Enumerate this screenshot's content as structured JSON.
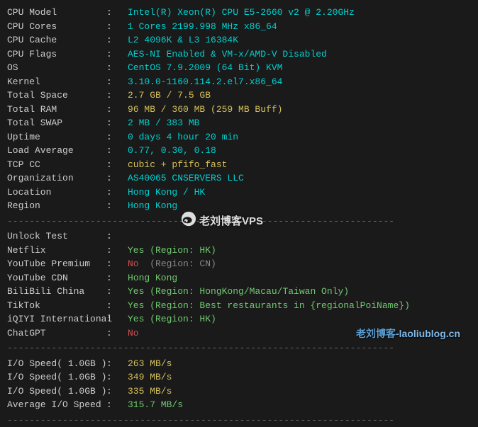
{
  "system": {
    "cpu_model": {
      "label": "CPU Model",
      "value": "Intel(R) Xeon(R) CPU E5-2660 v2 @ 2.20GHz"
    },
    "cpu_cores": {
      "label": "CPU Cores",
      "value": "1 Cores 2199.998 MHz x86_64"
    },
    "cpu_cache": {
      "label": "CPU Cache",
      "value": "L2 4096K & L3 16384K"
    },
    "cpu_flags": {
      "label": "CPU Flags",
      "value": "AES-NI Enabled & VM-x/AMD-V Disabled"
    },
    "os": {
      "label": "OS",
      "value": "CentOS 7.9.2009 (64 Bit) KVM"
    },
    "kernel": {
      "label": "Kernel",
      "value": "3.10.0-1160.114.2.el7.x86_64"
    },
    "total_space": {
      "label": "Total Space",
      "value": "2.7 GB / 7.5 GB"
    },
    "total_ram": {
      "label": "Total RAM",
      "value": "96 MB / 360 MB (259 MB Buff)"
    },
    "total_swap": {
      "label": "Total SWAP",
      "value": "2 MB / 383 MB"
    },
    "uptime": {
      "label": "Uptime",
      "value": "0 days 4 hour 20 min"
    },
    "load_avg": {
      "label": "Load Average",
      "value": "0.77, 0.30, 0.18"
    },
    "tcp_cc": {
      "label": "TCP CC",
      "value": "cubic + pfifo_fast"
    },
    "organization": {
      "label": "Organization",
      "value": "AS40065 CNSERVERS LLC"
    },
    "location": {
      "label": "Location",
      "value": "Hong Kong / HK"
    },
    "region": {
      "label": "Region",
      "value": "Hong Kong"
    }
  },
  "unlock": {
    "header": {
      "label": "Unlock Test",
      "value": ""
    },
    "netflix": {
      "label": "Netflix",
      "status": "Yes",
      "detail": " (Region: HK)"
    },
    "youtube_premium": {
      "label": "YouTube Premium",
      "status": "No",
      "detail": "  (Region: CN)"
    },
    "youtube_cdn": {
      "label": "YouTube CDN",
      "value": "Hong Kong"
    },
    "bilibili": {
      "label": "BiliBili China",
      "status": "Yes",
      "detail": " (Region: HongKong/Macau/Taiwan Only)"
    },
    "tiktok": {
      "label": "TikTok",
      "status": "Yes",
      "detail": " (Region: Best restaurants in {regionalPoiName})"
    },
    "iqiyi": {
      "label": "iQIYI International",
      "status": "Yes",
      "detail": " (Region: HK)"
    },
    "chatgpt": {
      "label": "ChatGPT",
      "status": "No",
      "detail": ""
    }
  },
  "io": {
    "test1": {
      "label": "I/O Speed( 1.0GB )",
      "value": "263 MB/s"
    },
    "test2": {
      "label": "I/O Speed( 1.0GB )",
      "value": "349 MB/s"
    },
    "test3": {
      "label": "I/O Speed( 1.0GB )",
      "value": "335 MB/s"
    },
    "avg": {
      "label": "Average I/O Speed",
      "value": "315.7 MB/s"
    }
  },
  "watermark": {
    "center": "老刘博客VPS",
    "bottom_prefix": "老刘博客",
    "bottom_suffix": "-laoliublog.cn"
  },
  "sep": ":  "
}
